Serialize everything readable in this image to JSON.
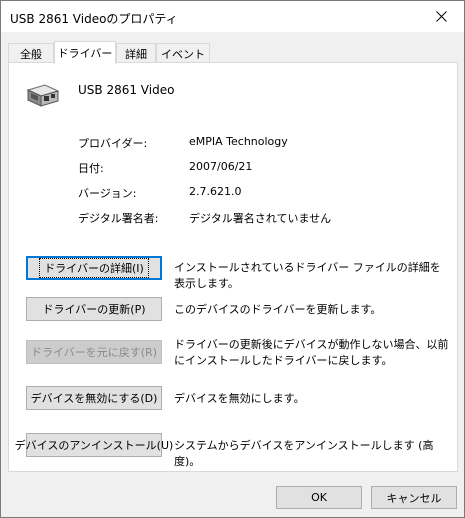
{
  "window": {
    "title": "USB 2861 Videoのプロパティ"
  },
  "tabs": [
    {
      "label": "全般"
    },
    {
      "label": "ドライバー"
    },
    {
      "label": "詳細"
    },
    {
      "label": "イベント"
    }
  ],
  "device": {
    "name": "USB 2861 Video",
    "icon": "usb-device-icon"
  },
  "properties": [
    {
      "label": "プロバイダー:",
      "value": "eMPIA Technology"
    },
    {
      "label": "日付:",
      "value": "2007/06/21"
    },
    {
      "label": "バージョン:",
      "value": "2.7.621.0"
    },
    {
      "label": "デジタル署名者:",
      "value": "デジタル署名されていません"
    }
  ],
  "actions": [
    {
      "button": "ドライバーの詳細(I)",
      "description": "インストールされているドライバー ファイルの詳細を表示します。",
      "enabled": true
    },
    {
      "button": "ドライバーの更新(P)",
      "description": "このデバイスのドライバーを更新します。",
      "enabled": true
    },
    {
      "button": "ドライバーを元に戻す(R)",
      "description": "ドライバーの更新後にデバイスが動作しない場合、以前にインストールしたドライバーに戻します。",
      "enabled": false
    },
    {
      "button": "デバイスを無効にする(D)",
      "description": "デバイスを無効にします。",
      "enabled": true
    },
    {
      "button": "デバイスのアンインストール(U)",
      "description": "システムからデバイスをアンインストールします (高度)。",
      "enabled": true
    }
  ],
  "footer": {
    "ok": "OK",
    "cancel": "キャンセル"
  },
  "colors": {
    "focus_border": "#0078d7",
    "panel_bg": "#ffffff",
    "window_bg": "#f0f0f0"
  }
}
